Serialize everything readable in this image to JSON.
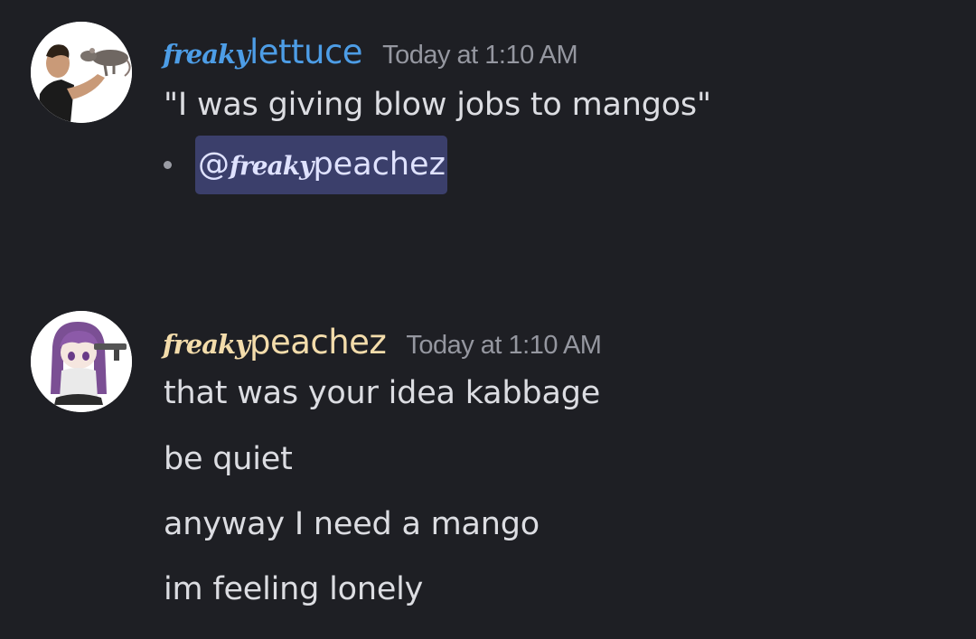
{
  "colors": {
    "background": "#1e1f24",
    "lettuce_name": "#4d9de6",
    "peachez_name": "#f3dcab",
    "timestamp": "#9597a0",
    "message_text": "#dcdde2",
    "mention_bg": "#3b3f6b",
    "mention_text": "#dfe2ff"
  },
  "messages": [
    {
      "author_script": "freaky",
      "author_plain": "lettuce",
      "timestamp": "Today at 1:10 AM",
      "lines": [
        "\"I was giving blow jobs to mangos\""
      ],
      "bullet": {
        "at": "@",
        "mention_script": "freaky",
        "mention_plain": "peachez"
      }
    },
    {
      "author_script": "freaky",
      "author_plain": "peachez",
      "timestamp": "Today at 1:10 AM",
      "lines": [
        "that was your idea kabbage",
        "be quiet",
        "anyway I need a mango",
        "im feeling lonely"
      ]
    }
  ]
}
